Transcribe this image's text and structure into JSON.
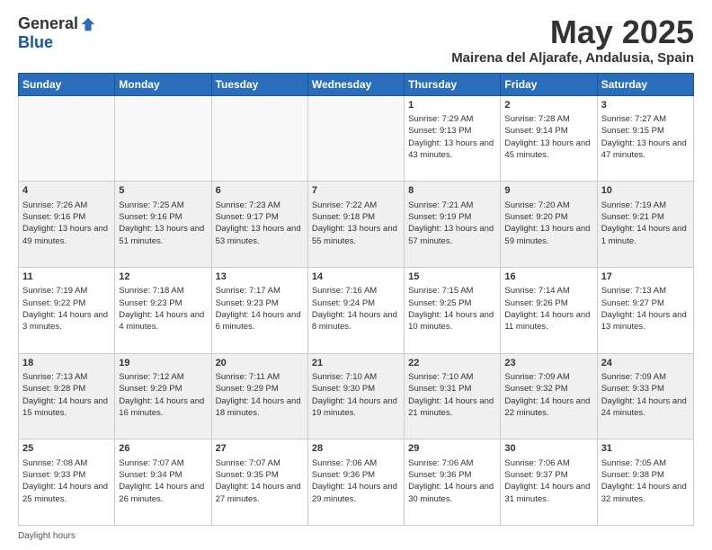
{
  "header": {
    "logo_general": "General",
    "logo_blue": "Blue",
    "month_title": "May 2025",
    "location": "Mairena del Aljarafe, Andalusia, Spain"
  },
  "days_of_week": [
    "Sunday",
    "Monday",
    "Tuesday",
    "Wednesday",
    "Thursday",
    "Friday",
    "Saturday"
  ],
  "footer": {
    "daylight_label": "Daylight hours"
  },
  "weeks": [
    {
      "cells": [
        {
          "day": "",
          "empty": true
        },
        {
          "day": "",
          "empty": true
        },
        {
          "day": "",
          "empty": true
        },
        {
          "day": "",
          "empty": true
        },
        {
          "day": "1",
          "sunrise": "Sunrise: 7:29 AM",
          "sunset": "Sunset: 9:13 PM",
          "daylight": "Daylight: 13 hours and 43 minutes."
        },
        {
          "day": "2",
          "sunrise": "Sunrise: 7:28 AM",
          "sunset": "Sunset: 9:14 PM",
          "daylight": "Daylight: 13 hours and 45 minutes."
        },
        {
          "day": "3",
          "sunrise": "Sunrise: 7:27 AM",
          "sunset": "Sunset: 9:15 PM",
          "daylight": "Daylight: 13 hours and 47 minutes."
        }
      ]
    },
    {
      "cells": [
        {
          "day": "4",
          "sunrise": "Sunrise: 7:26 AM",
          "sunset": "Sunset: 9:16 PM",
          "daylight": "Daylight: 13 hours and 49 minutes."
        },
        {
          "day": "5",
          "sunrise": "Sunrise: 7:25 AM",
          "sunset": "Sunset: 9:16 PM",
          "daylight": "Daylight: 13 hours and 51 minutes."
        },
        {
          "day": "6",
          "sunrise": "Sunrise: 7:23 AM",
          "sunset": "Sunset: 9:17 PM",
          "daylight": "Daylight: 13 hours and 53 minutes."
        },
        {
          "day": "7",
          "sunrise": "Sunrise: 7:22 AM",
          "sunset": "Sunset: 9:18 PM",
          "daylight": "Daylight: 13 hours and 55 minutes."
        },
        {
          "day": "8",
          "sunrise": "Sunrise: 7:21 AM",
          "sunset": "Sunset: 9:19 PM",
          "daylight": "Daylight: 13 hours and 57 minutes."
        },
        {
          "day": "9",
          "sunrise": "Sunrise: 7:20 AM",
          "sunset": "Sunset: 9:20 PM",
          "daylight": "Daylight: 13 hours and 59 minutes."
        },
        {
          "day": "10",
          "sunrise": "Sunrise: 7:19 AM",
          "sunset": "Sunset: 9:21 PM",
          "daylight": "Daylight: 14 hours and 1 minute."
        }
      ]
    },
    {
      "cells": [
        {
          "day": "11",
          "sunrise": "Sunrise: 7:19 AM",
          "sunset": "Sunset: 9:22 PM",
          "daylight": "Daylight: 14 hours and 3 minutes."
        },
        {
          "day": "12",
          "sunrise": "Sunrise: 7:18 AM",
          "sunset": "Sunset: 9:23 PM",
          "daylight": "Daylight: 14 hours and 4 minutes."
        },
        {
          "day": "13",
          "sunrise": "Sunrise: 7:17 AM",
          "sunset": "Sunset: 9:23 PM",
          "daylight": "Daylight: 14 hours and 6 minutes."
        },
        {
          "day": "14",
          "sunrise": "Sunrise: 7:16 AM",
          "sunset": "Sunset: 9:24 PM",
          "daylight": "Daylight: 14 hours and 8 minutes."
        },
        {
          "day": "15",
          "sunrise": "Sunrise: 7:15 AM",
          "sunset": "Sunset: 9:25 PM",
          "daylight": "Daylight: 14 hours and 10 minutes."
        },
        {
          "day": "16",
          "sunrise": "Sunrise: 7:14 AM",
          "sunset": "Sunset: 9:26 PM",
          "daylight": "Daylight: 14 hours and 11 minutes."
        },
        {
          "day": "17",
          "sunrise": "Sunrise: 7:13 AM",
          "sunset": "Sunset: 9:27 PM",
          "daylight": "Daylight: 14 hours and 13 minutes."
        }
      ]
    },
    {
      "cells": [
        {
          "day": "18",
          "sunrise": "Sunrise: 7:13 AM",
          "sunset": "Sunset: 9:28 PM",
          "daylight": "Daylight: 14 hours and 15 minutes."
        },
        {
          "day": "19",
          "sunrise": "Sunrise: 7:12 AM",
          "sunset": "Sunset: 9:29 PM",
          "daylight": "Daylight: 14 hours and 16 minutes."
        },
        {
          "day": "20",
          "sunrise": "Sunrise: 7:11 AM",
          "sunset": "Sunset: 9:29 PM",
          "daylight": "Daylight: 14 hours and 18 minutes."
        },
        {
          "day": "21",
          "sunrise": "Sunrise: 7:10 AM",
          "sunset": "Sunset: 9:30 PM",
          "daylight": "Daylight: 14 hours and 19 minutes."
        },
        {
          "day": "22",
          "sunrise": "Sunrise: 7:10 AM",
          "sunset": "Sunset: 9:31 PM",
          "daylight": "Daylight: 14 hours and 21 minutes."
        },
        {
          "day": "23",
          "sunrise": "Sunrise: 7:09 AM",
          "sunset": "Sunset: 9:32 PM",
          "daylight": "Daylight: 14 hours and 22 minutes."
        },
        {
          "day": "24",
          "sunrise": "Sunrise: 7:09 AM",
          "sunset": "Sunset: 9:33 PM",
          "daylight": "Daylight: 14 hours and 24 minutes."
        }
      ]
    },
    {
      "cells": [
        {
          "day": "25",
          "sunrise": "Sunrise: 7:08 AM",
          "sunset": "Sunset: 9:33 PM",
          "daylight": "Daylight: 14 hours and 25 minutes."
        },
        {
          "day": "26",
          "sunrise": "Sunrise: 7:07 AM",
          "sunset": "Sunset: 9:34 PM",
          "daylight": "Daylight: 14 hours and 26 minutes."
        },
        {
          "day": "27",
          "sunrise": "Sunrise: 7:07 AM",
          "sunset": "Sunset: 9:35 PM",
          "daylight": "Daylight: 14 hours and 27 minutes."
        },
        {
          "day": "28",
          "sunrise": "Sunrise: 7:06 AM",
          "sunset": "Sunset: 9:36 PM",
          "daylight": "Daylight: 14 hours and 29 minutes."
        },
        {
          "day": "29",
          "sunrise": "Sunrise: 7:06 AM",
          "sunset": "Sunset: 9:36 PM",
          "daylight": "Daylight: 14 hours and 30 minutes."
        },
        {
          "day": "30",
          "sunrise": "Sunrise: 7:06 AM",
          "sunset": "Sunset: 9:37 PM",
          "daylight": "Daylight: 14 hours and 31 minutes."
        },
        {
          "day": "31",
          "sunrise": "Sunrise: 7:05 AM",
          "sunset": "Sunset: 9:38 PM",
          "daylight": "Daylight: 14 hours and 32 minutes."
        }
      ]
    }
  ]
}
